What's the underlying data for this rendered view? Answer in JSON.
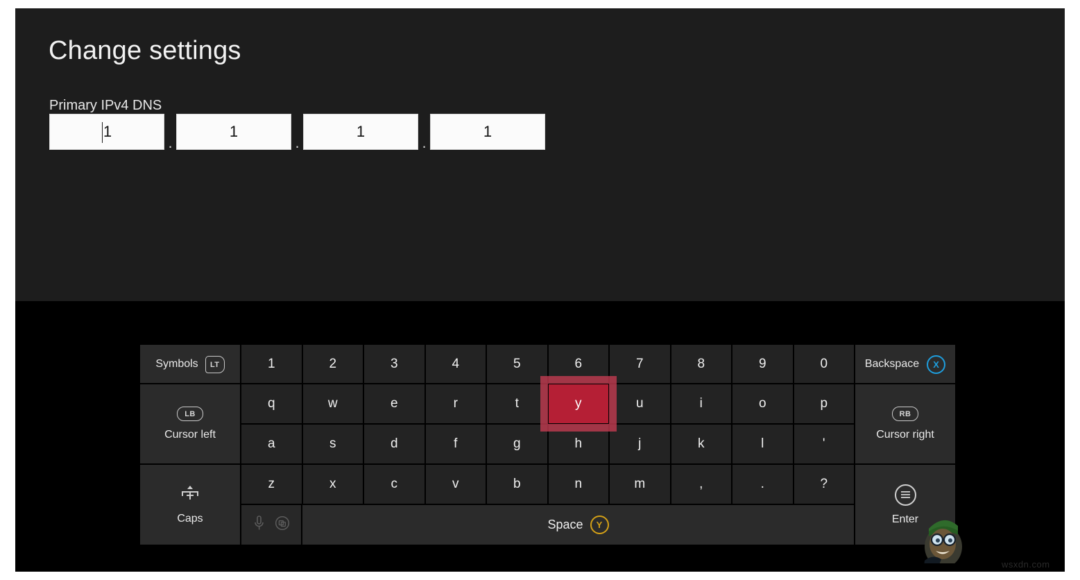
{
  "settings": {
    "title": "Change settings",
    "field_label": "Primary IPv4 DNS",
    "separator": ".",
    "octets": [
      {
        "value": "1",
        "has_caret": true
      },
      {
        "value": "1",
        "has_caret": false
      },
      {
        "value": "1",
        "has_caret": false
      },
      {
        "value": "1",
        "has_caret": false
      }
    ]
  },
  "keyboard": {
    "left_panel": {
      "symbols_label": "Symbols",
      "symbols_badge": "LT",
      "cursor_left_label": "Cursor left",
      "cursor_left_badge": "LB",
      "caps_label": "Caps",
      "caps_icon": "shift-caps-icon"
    },
    "right_panel": {
      "backspace_label": "Backspace",
      "backspace_badge": "X",
      "cursor_right_label": "Cursor right",
      "cursor_right_badge": "RB",
      "enter_label": "Enter",
      "enter_icon": "menu-icon"
    },
    "rows": {
      "numbers": [
        "1",
        "2",
        "3",
        "4",
        "5",
        "6",
        "7",
        "8",
        "9",
        "0"
      ],
      "top": [
        "q",
        "w",
        "e",
        "r",
        "t",
        "y",
        "u",
        "i",
        "o",
        "p"
      ],
      "home": [
        "a",
        "s",
        "d",
        "f",
        "g",
        "h",
        "j",
        "k",
        "l",
        "'"
      ],
      "bottom": [
        "z",
        "x",
        "c",
        "v",
        "b",
        "n",
        "m",
        ",",
        ".",
        "?"
      ]
    },
    "highlighted_key": "y",
    "space_label": "Space",
    "space_badge": "Y",
    "media_icons": [
      "microphone-icon",
      "clipboard-icon"
    ]
  },
  "colors": {
    "panel_bg": "#1d1d1d",
    "stage_bg": "#000000",
    "key_bg": "#232323",
    "side_key_bg": "#2b2b2b",
    "highlight_red": "#b51f35",
    "highlight_glow": "#c73c52",
    "badge_blue": "#1e9ede",
    "badge_amber": "#d4a017",
    "text": "#f0f0f0"
  },
  "watermark": "wsxdn.com"
}
